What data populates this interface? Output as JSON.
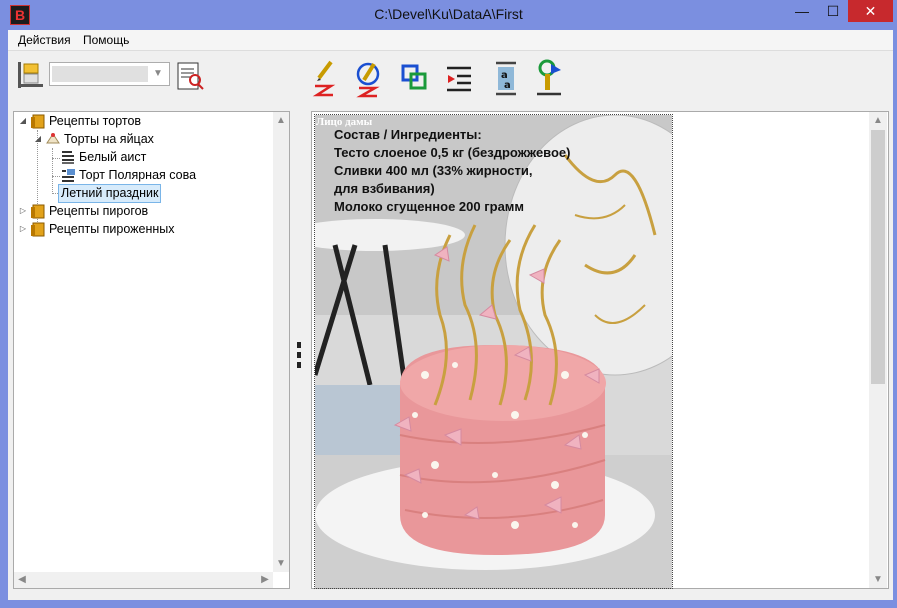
{
  "window": {
    "title": "C:\\Devel\\Ku\\DataA\\First",
    "app_icon_letter": "B",
    "minimize_glyph": "—",
    "maximize_glyph": "☐",
    "close_glyph": "✕"
  },
  "menu": {
    "items": [
      "Действия",
      "Помощь"
    ]
  },
  "toolbar": {
    "combo_value": "",
    "buttons": [
      "edit-z-icon",
      "edit-z-circle-icon",
      "link-boxes-icon",
      "text-align-icon",
      "text-height-icon",
      "upload-icon"
    ]
  },
  "tree": {
    "items": [
      {
        "label": "Рецепты тортов",
        "icon": "folder-book-icon",
        "expander": "◢"
      },
      {
        "label": "Торты на яйцах",
        "icon": "cake-slice-icon",
        "expander": "◢"
      },
      {
        "label": "Белый аист",
        "icon": "document-lines-icon"
      },
      {
        "label": "Торт Полярная сова",
        "icon": "document-image-icon"
      },
      {
        "label": "Летний праздник",
        "icon": ""
      },
      {
        "label": "Рецепты пирогов",
        "icon": "folder-book-icon",
        "expander": "▷"
      },
      {
        "label": "Рецепты пироженных",
        "icon": "folder-book-icon",
        "expander": "▷"
      }
    ]
  },
  "view": {
    "image_caption": "Лицо дамы",
    "ingredients_title": "Состав / Ингредиенты:",
    "lines": [
      "Тесто слоеное 0,5 кг (бездрожжевое)",
      "Сливки 400 мл (33% жирности,",
      "для взбивания)",
      "Молоко сгущенное 200 грамм"
    ]
  },
  "colors": {
    "titlebar": "#7b8fe0",
    "close_button": "#c7292d",
    "selection": "#d7ebfb",
    "cake_pink": "#e9979a"
  }
}
